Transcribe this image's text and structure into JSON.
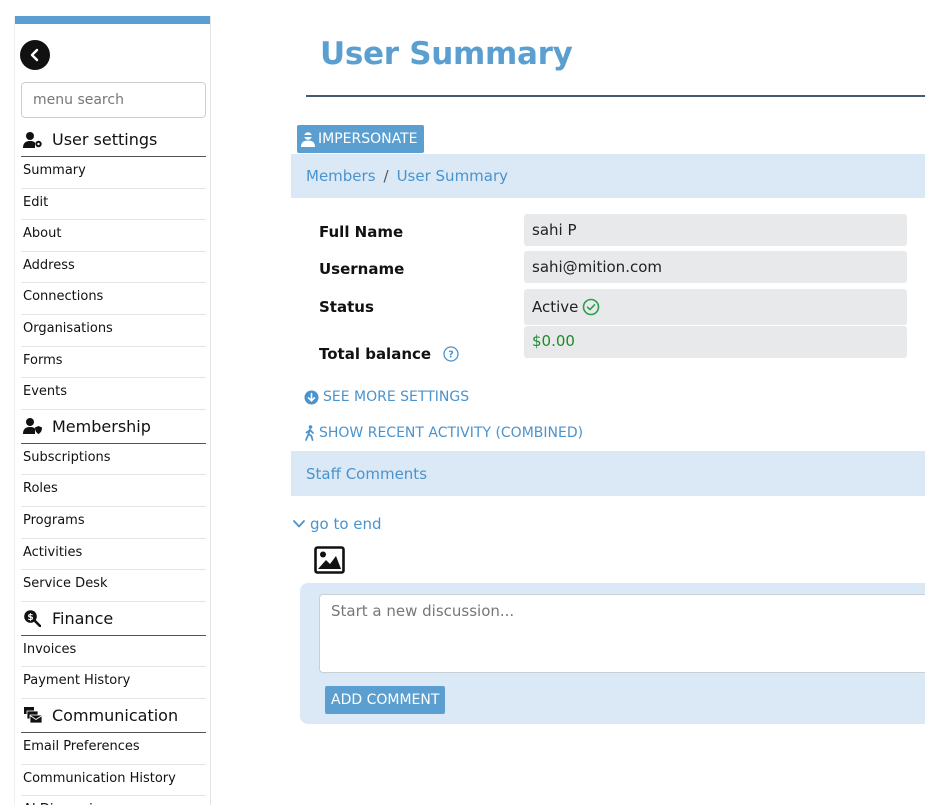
{
  "sidebar": {
    "search_placeholder": "menu search",
    "sections": [
      {
        "title": "User settings",
        "icon": "user-gear-icon",
        "items": [
          "Summary",
          "Edit",
          "About",
          "Address",
          "Connections",
          "Organisations",
          "Forms",
          "Events"
        ]
      },
      {
        "title": "Membership",
        "icon": "user-shield-icon",
        "items": [
          "Subscriptions",
          "Roles",
          "Programs",
          "Activities",
          "Service Desk"
        ]
      },
      {
        "title": "Finance",
        "icon": "search-dollar-icon",
        "items": [
          "Invoices",
          "Payment History"
        ]
      },
      {
        "title": "Communication",
        "icon": "mail-bulk-icon",
        "items": [
          "Email Preferences",
          "Communication History",
          "AI Discussions"
        ]
      }
    ]
  },
  "main": {
    "title": "User Summary",
    "impersonate_label": "IMPERSONATE",
    "breadcrumb": [
      "Members",
      "User Summary"
    ],
    "fields": [
      {
        "label": "Full Name",
        "value": "sahi P"
      },
      {
        "label": "Username",
        "value": "sahi@mition.com"
      },
      {
        "label": "Status",
        "value": "Active"
      },
      {
        "label": "Total balance",
        "value": "$0.00"
      }
    ],
    "see_more_label": "SEE MORE SETTINGS",
    "recent_activity_label": "SHOW RECENT ACTIVITY (COMBINED)",
    "staff_comments_label": "Staff Comments",
    "goto_end_label": "go to end",
    "comment_placeholder": "Start a new discussion...",
    "add_comment_label": "ADD COMMENT"
  },
  "colors": {
    "accent": "#5b9fd1",
    "link": "#4b93cc",
    "panel": "#dbe9f6",
    "status_ok": "#2e9e4f",
    "balance": "#1e8a2e"
  }
}
